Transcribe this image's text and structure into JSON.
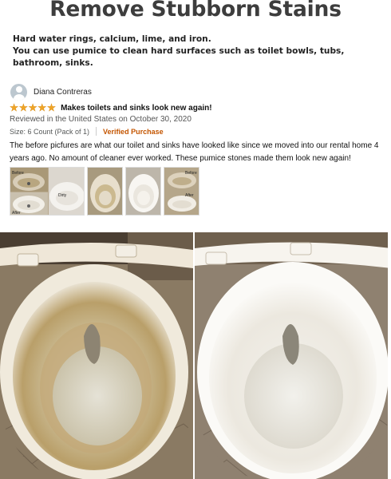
{
  "headline": "Remove Stubborn Stains",
  "subheading": {
    "line1": "Hard water rings, calcium, lime, and iron.",
    "line2": "You can use pumice to clean hard surfaces such as toilet bowls, tubs, bathroom, sinks."
  },
  "review": {
    "reviewer_name": "Diana Contreras",
    "rating": 5,
    "title": "Makes toilets and sinks look new again!",
    "date_line": "Reviewed in the United States on October 30, 2020",
    "size_line": "Size: 6 Count (Pack of 1)",
    "verified_label": "Verified Purchase",
    "body": "The before picfures are what our toilet and sinks have looked like since we moved into our rental home 4 years ago. No amount of cleaner ever worked. These pumice stones made them look new again!"
  },
  "thumbnails": [
    {
      "label_top": "Before",
      "label_bottom": "After",
      "label_side": "Dirty"
    },
    {
      "label_top": "",
      "label_bottom": "",
      "label_side": ""
    },
    {
      "label_top": "",
      "label_bottom": "",
      "label_side": ""
    },
    {
      "label_top": "Before",
      "label_bottom": "After",
      "label_side": ""
    }
  ],
  "photos": {
    "before_alt": "before",
    "after_alt": "after"
  },
  "colors": {
    "star": "#f0a526",
    "verified": "#c45500",
    "headline": "#3d3d3d"
  }
}
